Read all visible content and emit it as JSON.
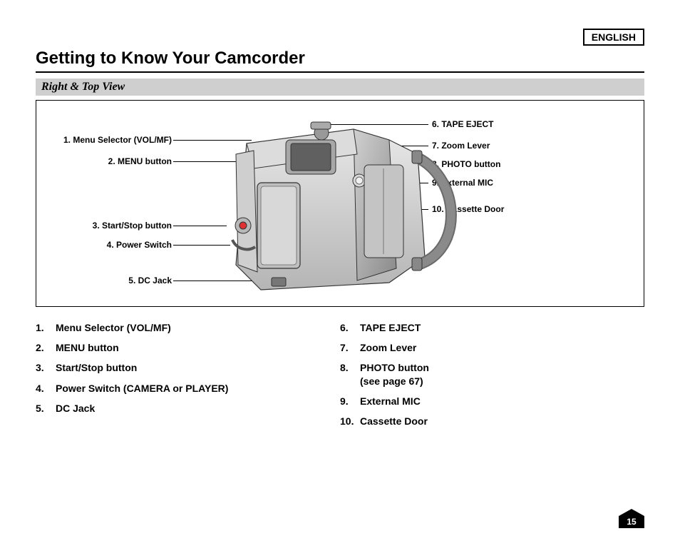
{
  "header": {
    "language": "ENGLISH",
    "title": "Getting to Know Your Camcorder",
    "subtitle": "Right & Top View"
  },
  "diagram_labels": {
    "left": [
      "1. Menu Selector (VOL/MF)",
      "2. MENU button",
      "3. Start/Stop button",
      "4. Power Switch",
      "5. DC Jack"
    ],
    "right": [
      "6. TAPE EJECT",
      "7. Zoom Lever",
      "8. PHOTO button",
      "9. External MIC",
      "10. Cassette Door"
    ]
  },
  "list_left": [
    {
      "num": "1.",
      "text": "Menu Selector (VOL/MF)"
    },
    {
      "num": "2.",
      "text": "MENU button"
    },
    {
      "num": "3.",
      "text": "Start/Stop button"
    },
    {
      "num": "4.",
      "text": "Power Switch (CAMERA or PLAYER)"
    },
    {
      "num": "5.",
      "text": "DC Jack"
    }
  ],
  "list_right": [
    {
      "num": "6.",
      "text": "TAPE EJECT"
    },
    {
      "num": "7.",
      "text": "Zoom Lever"
    },
    {
      "num": "8.",
      "text": "PHOTO button",
      "sub": "(see page 67)"
    },
    {
      "num": "9.",
      "text": "External MIC"
    },
    {
      "num": "10.",
      "text": "Cassette Door"
    }
  ],
  "page_number": "15"
}
